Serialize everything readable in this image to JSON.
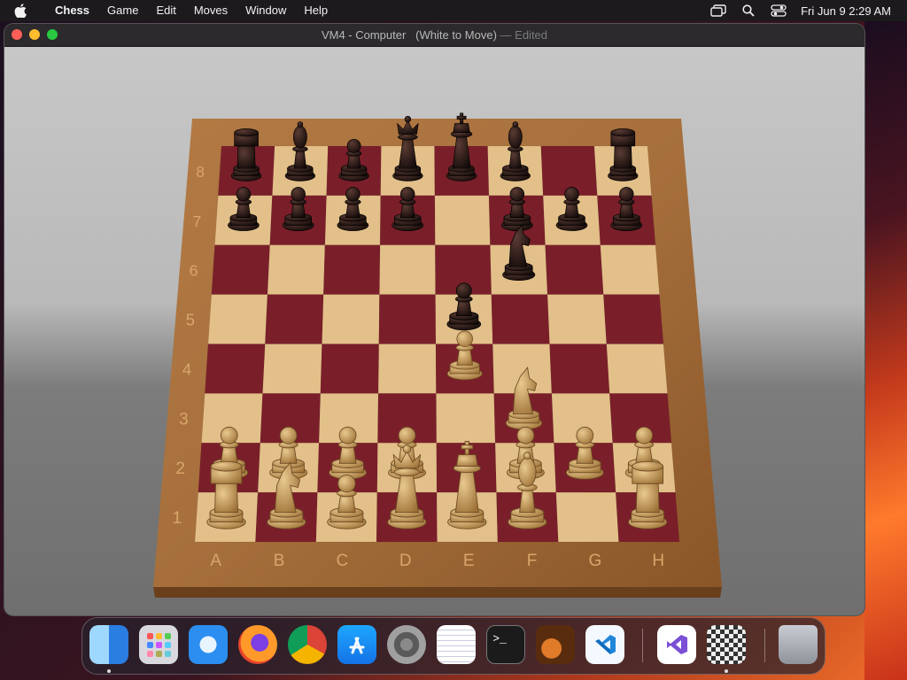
{
  "menubar": {
    "apple_icon": "apple-logo-icon",
    "app_name": "Chess",
    "items": [
      "Game",
      "Edit",
      "Moves",
      "Window",
      "Help"
    ],
    "status_icons": [
      "screen-mirroring-icon",
      "spotlight-search-icon",
      "control-center-icon"
    ],
    "clock": "Fri Jun 9  2:29 AM"
  },
  "window": {
    "title": "VM4 - Computer   (White to Move)",
    "title_separator": "—",
    "title_status": "Edited"
  },
  "board": {
    "file_labels": [
      "A",
      "B",
      "C",
      "D",
      "E",
      "F",
      "G",
      "H"
    ],
    "rank_labels": [
      "1",
      "2",
      "3",
      "4",
      "5",
      "6",
      "7",
      "8"
    ],
    "colors": {
      "light_square": "#e3c08a",
      "dark_square": "#7a1f2a",
      "frame": "#a66f3c",
      "white_piece": "#c9a165",
      "black_piece": "#2a1a18"
    },
    "pieces": [
      {
        "square": "a8",
        "color": "black",
        "type": "rook"
      },
      {
        "square": "b8",
        "color": "black",
        "type": "bishop"
      },
      {
        "square": "c8",
        "color": "black",
        "type": "pawn"
      },
      {
        "square": "d8",
        "color": "black",
        "type": "queen"
      },
      {
        "square": "e8",
        "color": "black",
        "type": "king"
      },
      {
        "square": "f8",
        "color": "black",
        "type": "bishop"
      },
      {
        "square": "h8",
        "color": "black",
        "type": "rook"
      },
      {
        "square": "a7",
        "color": "black",
        "type": "pawn"
      },
      {
        "square": "b7",
        "color": "black",
        "type": "pawn"
      },
      {
        "square": "c7",
        "color": "black",
        "type": "pawn"
      },
      {
        "square": "d7",
        "color": "black",
        "type": "pawn"
      },
      {
        "square": "f7",
        "color": "black",
        "type": "pawn"
      },
      {
        "square": "g7",
        "color": "black",
        "type": "pawn"
      },
      {
        "square": "h7",
        "color": "black",
        "type": "pawn"
      },
      {
        "square": "f6",
        "color": "black",
        "type": "knight"
      },
      {
        "square": "e5",
        "color": "black",
        "type": "pawn"
      },
      {
        "square": "e4",
        "color": "white",
        "type": "pawn"
      },
      {
        "square": "f3",
        "color": "white",
        "type": "knight"
      },
      {
        "square": "a2",
        "color": "white",
        "type": "pawn"
      },
      {
        "square": "b2",
        "color": "white",
        "type": "pawn"
      },
      {
        "square": "c2",
        "color": "white",
        "type": "pawn"
      },
      {
        "square": "d2",
        "color": "white",
        "type": "pawn"
      },
      {
        "square": "f2",
        "color": "white",
        "type": "pawn"
      },
      {
        "square": "g2",
        "color": "white",
        "type": "pawn"
      },
      {
        "square": "h2",
        "color": "white",
        "type": "pawn"
      },
      {
        "square": "a1",
        "color": "white",
        "type": "rook"
      },
      {
        "square": "b1",
        "color": "white",
        "type": "knight"
      },
      {
        "square": "c1",
        "color": "white",
        "type": "pawn"
      },
      {
        "square": "d1",
        "color": "white",
        "type": "queen"
      },
      {
        "square": "e1",
        "color": "white",
        "type": "king"
      },
      {
        "square": "f1",
        "color": "white",
        "type": "bishop"
      },
      {
        "square": "h1",
        "color": "white",
        "type": "rook"
      }
    ]
  },
  "dock": {
    "apps": [
      {
        "name": "Finder",
        "icon": "finder-icon",
        "running": true
      },
      {
        "name": "Launchpad",
        "icon": "launchpad-icon",
        "running": false
      },
      {
        "name": "Safari",
        "icon": "safari-icon",
        "running": false
      },
      {
        "name": "Firefox",
        "icon": "firefox-icon",
        "running": false
      },
      {
        "name": "Google Chrome",
        "icon": "chrome-icon",
        "running": false
      },
      {
        "name": "App Store",
        "icon": "app-store-icon",
        "running": false
      },
      {
        "name": "System Settings",
        "icon": "system-settings-icon",
        "running": false
      },
      {
        "name": "TextEdit",
        "icon": "textedit-icon",
        "running": false
      },
      {
        "name": "Terminal",
        "icon": "terminal-icon",
        "running": false
      },
      {
        "name": "GarageBand",
        "icon": "garageband-icon",
        "running": false
      },
      {
        "name": "Visual Studio Code",
        "icon": "vscode-icon",
        "running": false
      },
      {
        "name": "Visual Studio",
        "icon": "visual-studio-icon",
        "running": false
      },
      {
        "name": "Chess",
        "icon": "chess-icon",
        "running": true
      },
      {
        "name": "Trash",
        "icon": "trash-icon",
        "running": false
      }
    ]
  }
}
